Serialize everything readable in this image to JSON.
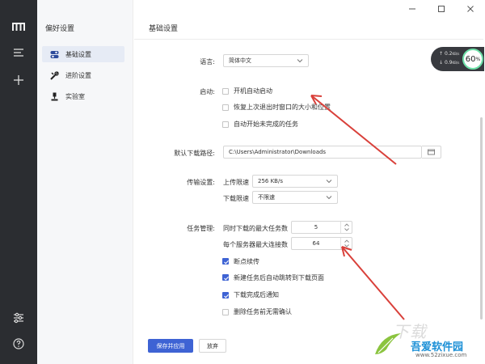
{
  "nav": {
    "title": "偏好设置",
    "items": [
      {
        "label": "基础设置",
        "icon": "settings-toggle-icon",
        "active": true
      },
      {
        "label": "进阶设置",
        "icon": "wrench-icon",
        "active": false
      },
      {
        "label": "实验室",
        "icon": "lab-icon",
        "active": false
      }
    ]
  },
  "rail": {
    "icons": [
      "logo-icon",
      "menu-icon",
      "add-icon",
      "sliders-icon",
      "help-icon"
    ]
  },
  "main": {
    "title": "基础设置",
    "language": {
      "label": "语言:",
      "value": "简体中文"
    },
    "startup": {
      "label": "启动:",
      "options": [
        {
          "label": "开机自动启动",
          "checked": false
        },
        {
          "label": "恢复上次退出时窗口的大小和位置",
          "checked": false
        },
        {
          "label": "自动开始未完成的任务",
          "checked": false
        }
      ]
    },
    "download_path": {
      "label": "默认下载路径:",
      "value": "C:\\Users\\Administrator\\Downloads"
    },
    "transfer": {
      "label": "传输设置:",
      "upload_label": "上传限速",
      "upload_value": "256 KB/s",
      "download_label": "下载限速",
      "download_value": "不限速"
    },
    "tasks": {
      "label": "任务管理:",
      "max_tasks_label": "同时下载的最大任务数",
      "max_tasks_value": "5",
      "max_conn_label": "每个服务器最大连接数",
      "max_conn_value": "64",
      "options": [
        {
          "label": "断点续传",
          "checked": true
        },
        {
          "label": "新建任务后自动跳转到下载页面",
          "checked": true
        },
        {
          "label": "下载完成后通知",
          "checked": true
        },
        {
          "label": "删除任务前无需确认",
          "checked": false
        }
      ]
    },
    "buttons": {
      "save": "保存并应用",
      "discard": "放弃"
    }
  },
  "speed_widget": {
    "upload": "0.2",
    "download": "0.9",
    "unit": "KB/s",
    "percent": "60",
    "percent_unit": "%"
  },
  "watermark": {
    "name": "吾爱软件园",
    "url": "www.52zixue.com"
  },
  "colors": {
    "accent": "#3e63d4",
    "rail": "#2b2d31",
    "annotation_arrow": "#d9403a"
  }
}
